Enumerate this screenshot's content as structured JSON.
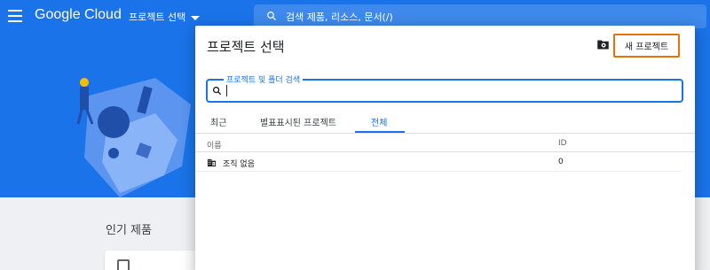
{
  "header": {
    "logo_text": "Google Cloud",
    "project_select_label": "프로젝트 선택",
    "search_text": "검색  제품, 리소스, 문서(/)",
    "icons": [
      "menu-icon",
      "search-icon",
      "caret-down-icon"
    ]
  },
  "background": {
    "popular_title": "인기 제품"
  },
  "modal": {
    "title": "프로젝트 선택",
    "new_project_label": "새 프로젝트",
    "search_label": "프로젝트 및 폴더 검색",
    "search_value": "",
    "tabs": [
      {
        "label": "최근"
      },
      {
        "label": "별표표시된 프로젝트"
      },
      {
        "label": "전체"
      }
    ],
    "active_tab": "전체",
    "columns": {
      "name": "이름",
      "id": "ID"
    },
    "rows": [
      {
        "name": "조직 없음",
        "id": "0",
        "icon": "building-icon"
      }
    ]
  },
  "colors": {
    "brand_blue": "#1a73e8",
    "highlight_orange": "#e8710a"
  }
}
